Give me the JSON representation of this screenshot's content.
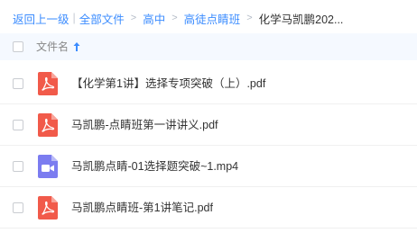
{
  "breadcrumb": {
    "back": "返回上一级",
    "all_files": "全部文件",
    "level1": "高中",
    "level2": "高徒点睛班",
    "current": "化学马凯鹏202..."
  },
  "list_header": {
    "name_label": "文件名"
  },
  "files": [
    {
      "name": "【化学第1讲】选择专项突破（上）.pdf",
      "type": "pdf"
    },
    {
      "name": "马凯鹏-点睛班第一讲讲义.pdf",
      "type": "pdf"
    },
    {
      "name": "马凯鹏点睛-01选择题突破~1.mp4",
      "type": "video"
    },
    {
      "name": "马凯鹏点睛班-第1讲笔记.pdf",
      "type": "pdf"
    }
  ],
  "colors": {
    "link": "#3b8cff",
    "pdf_icon": "#f15a4a",
    "video_icon": "#7b7cf0",
    "header_bg": "#f5f9ff"
  }
}
